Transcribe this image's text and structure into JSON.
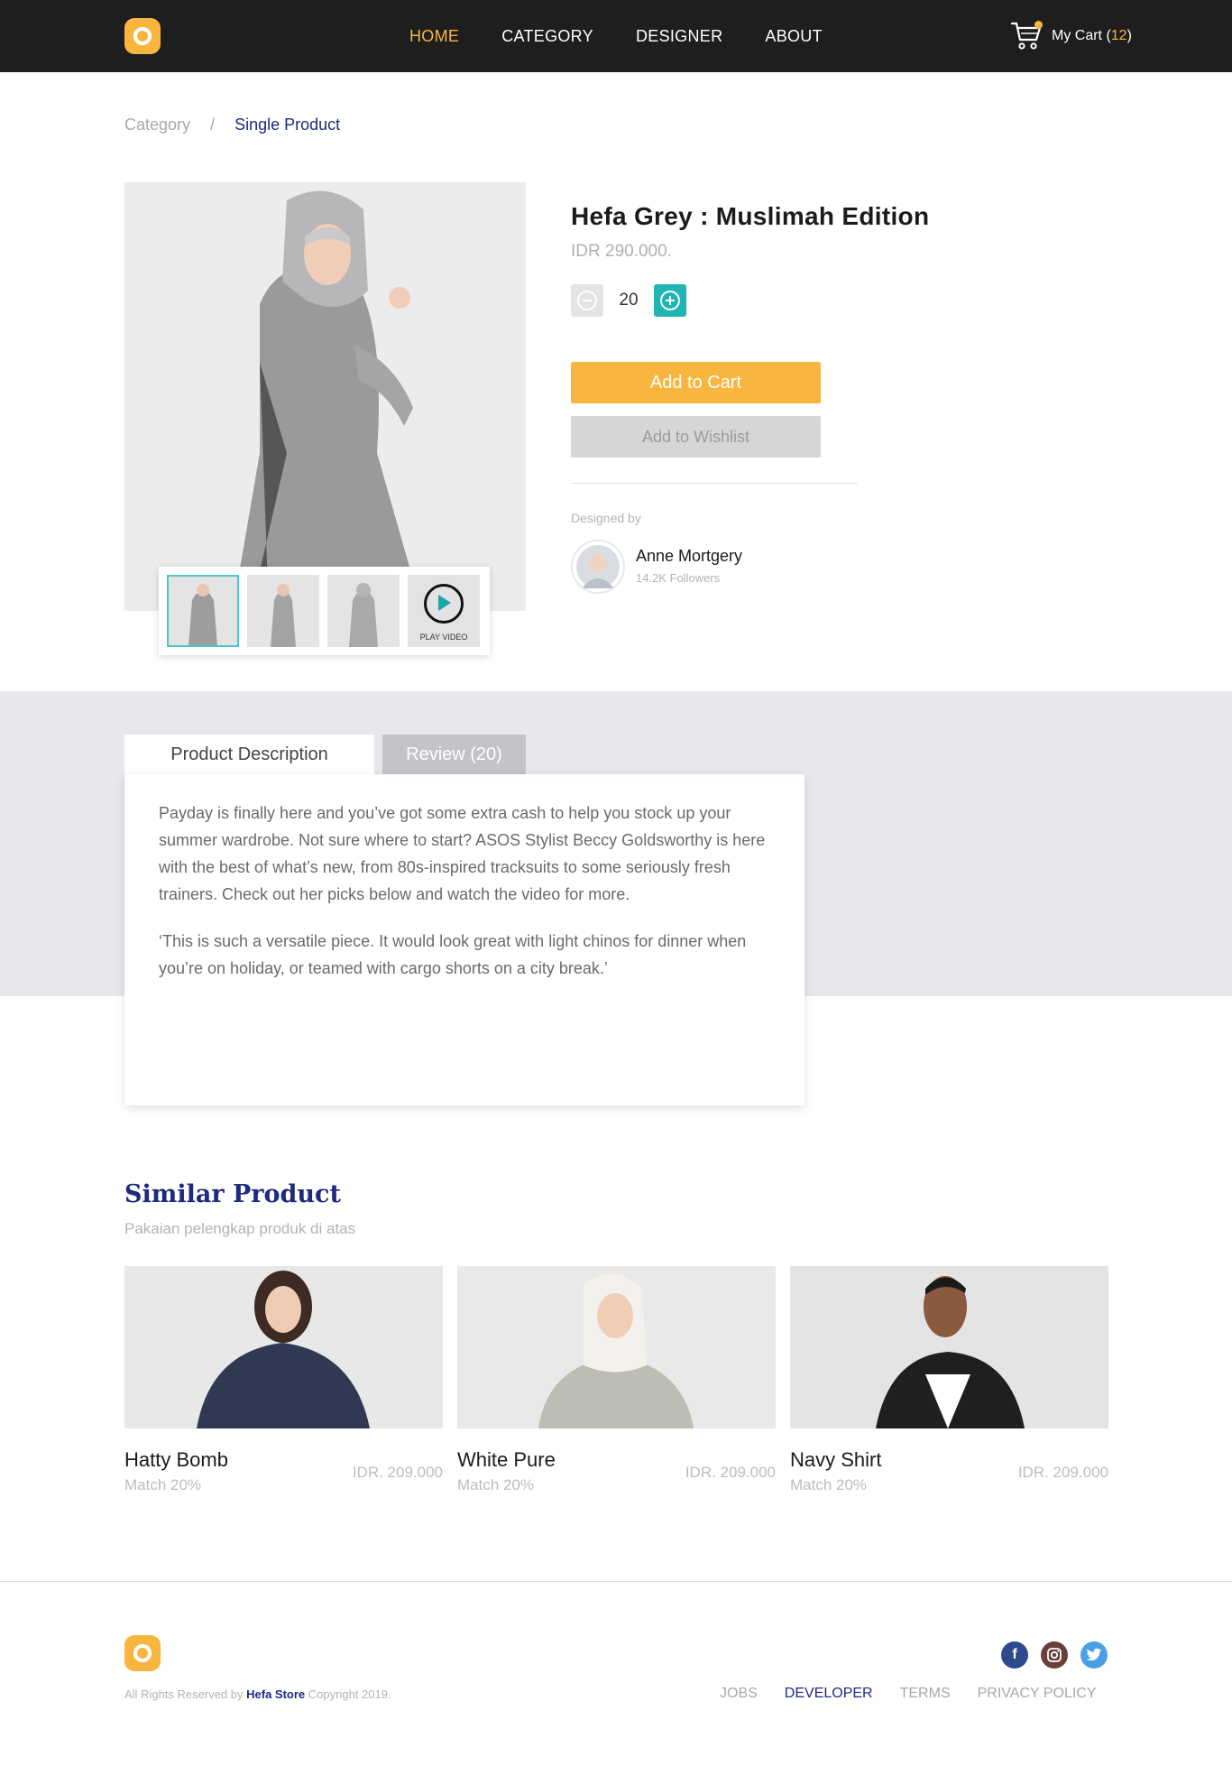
{
  "brand": {
    "name": "Hefa Store",
    "accent": "#f9b63f",
    "navy": "#1d2a7e",
    "teal": "#20b5b3"
  },
  "nav": {
    "items": [
      {
        "label": "HOME",
        "active": true
      },
      {
        "label": "CATEGORY",
        "active": false
      },
      {
        "label": "DESIGNER",
        "active": false
      },
      {
        "label": "ABOUT",
        "active": false
      }
    ],
    "cart_label": "My Cart",
    "cart_open": "(",
    "cart_count": "12",
    "cart_close": ")"
  },
  "breadcrumb": {
    "parent": "Category",
    "separator": "/",
    "current": "Single Product"
  },
  "product": {
    "title": "Hefa Grey : Muslimah Edition",
    "price": "IDR 290.000.",
    "quantity": "20",
    "add_to_cart": "Add to Cart",
    "add_to_wishlist": "Add to Wishlist",
    "thumbnails": [
      "front",
      "side",
      "back"
    ],
    "play_video_label": "PLAY VIDEO"
  },
  "designer": {
    "heading": "Designed by",
    "name": "Anne Mortgery",
    "followers": "14.2K Followers"
  },
  "tabs": {
    "description": "Product Description",
    "review": "Review (20)"
  },
  "description": {
    "p1": "Payday is finally here and you’ve got some extra cash to help you stock up your summer wardrobe. Not sure where to start? ASOS Stylist Beccy Goldsworthy is here with the best of what’s new, from 80s-inspired tracksuits to some seriously fresh trainers. Check out her picks below and watch the video for more.",
    "p2": "‘This is such a versatile piece. It would look great with light chinos for dinner when you’re on holiday, or teamed with cargo shorts on a city break.’"
  },
  "similar": {
    "title": "Similar Product",
    "subtitle": "Pakaian pelengkap produk di atas",
    "items": [
      {
        "name": "Hatty Bomb",
        "match": "Match 20%",
        "price": "IDR. 209.000"
      },
      {
        "name": "White Pure",
        "match": "Match 20%",
        "price": "IDR. 209.000"
      },
      {
        "name": "Navy Shirt",
        "match": "Match 20%",
        "price": "IDR. 209.000"
      }
    ]
  },
  "footer": {
    "rights_prefix": "All Rights Reserved by",
    "rights_brand": "Hefa Store",
    "rights_suffix": "Copyright 2019.",
    "links": [
      "JOBS",
      "DEVELOPER",
      "TERMS",
      "PRIVACY POLICY"
    ],
    "socials": [
      "facebook-icon",
      "instagram-icon",
      "twitter-icon"
    ]
  }
}
